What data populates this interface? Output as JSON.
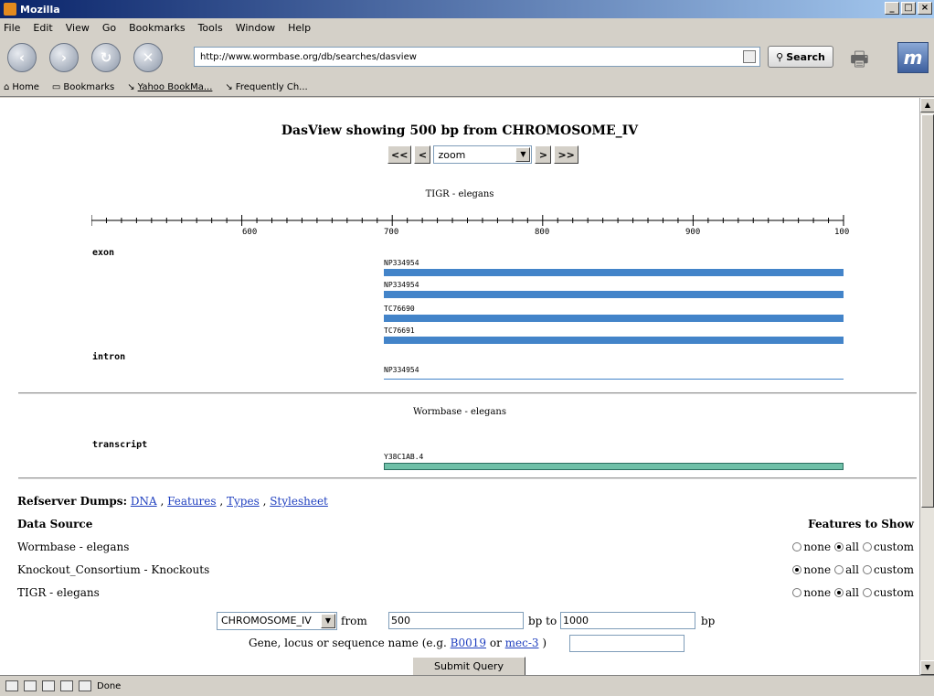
{
  "window": {
    "title": "Mozilla",
    "controls": [
      "_",
      "□",
      "×"
    ]
  },
  "menu": [
    "File",
    "Edit",
    "View",
    "Go",
    "Bookmarks",
    "Tools",
    "Window",
    "Help"
  ],
  "nav": {
    "url": "http://www.wormbase.org/db/searches/dasview",
    "search_label": "Search"
  },
  "bookmarks": [
    "Home",
    "Bookmarks",
    "Yahoo BookMa...",
    "Frequently Ch..."
  ],
  "page": {
    "title": "DasView showing 500 bp from CHROMOSOME_IV",
    "zoom": {
      "prev_far": "<<",
      "prev": "<",
      "select": "zoom",
      "next": ">",
      "next_far": ">>"
    },
    "track1": {
      "title": "TIGR - elegans",
      "ruler_labels": [
        "600",
        "700",
        "800",
        "900",
        "100"
      ],
      "exon_label": "exon",
      "exons": [
        "NP334954",
        "NP334954",
        "TC76690",
        "TC76691"
      ],
      "intron_label": "intron",
      "intron": "NP334954"
    },
    "track2": {
      "title": "Wormbase - elegans",
      "transcript_label": "transcript",
      "transcript": "Y38C1AB.4"
    },
    "dumps": {
      "label": "Refserver Dumps:",
      "links": [
        "DNA",
        "Features",
        "Types",
        "Stylesheet"
      ]
    },
    "data_source_header": "Data Source",
    "features_header": "Features to Show",
    "sources": [
      {
        "name": "Wormbase - elegans",
        "selected": "all"
      },
      {
        "name": "Knockout_Consortium - Knockouts",
        "selected": "none"
      },
      {
        "name": "TIGR - elegans",
        "selected": "all"
      }
    ],
    "radio_options": [
      "none",
      "all",
      "custom"
    ],
    "form": {
      "chromosome": "CHROMOSOME_IV",
      "from_label": "from",
      "from_value": "500",
      "to_label": "bp to",
      "to_value": "1000",
      "bp_label": "bp",
      "gene_prefix": "Gene, locus or sequence name (e.g.",
      "example1": "B0019",
      "or": "or",
      "example2": "mec-3",
      "gene_suffix": ")",
      "gene_value": "",
      "submit": "Submit Query"
    }
  },
  "status": {
    "text": "Done"
  },
  "colors": {
    "feature_bar": "#4384c9",
    "transcript_bar": "#6fc0a8",
    "link": "#1f3fbf"
  }
}
